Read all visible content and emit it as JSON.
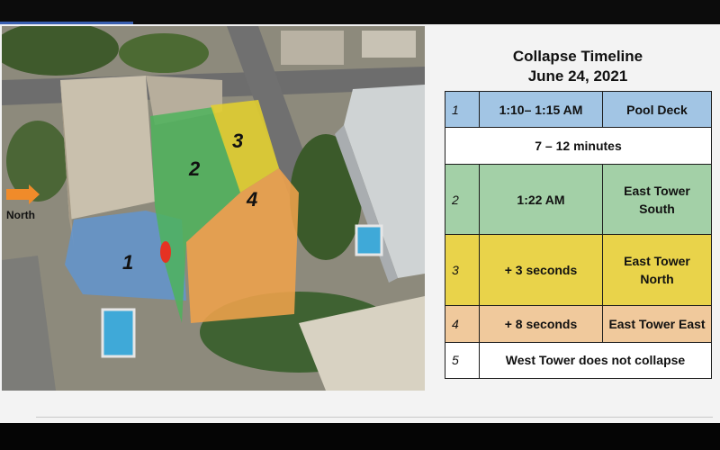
{
  "title": "Collapse Timeline",
  "subtitle": "June 24, 2021",
  "map": {
    "north_label": "North",
    "zones": [
      "1",
      "2",
      "3",
      "4"
    ]
  },
  "colors": {
    "pool_deck": "#a2c5e4",
    "south": "#a3d0a7",
    "north": "#e9d34a",
    "east": "#f0c99c"
  },
  "timeline": [
    {
      "num": "1",
      "time": "1:10– 1:15 AM",
      "event": "Pool Deck"
    },
    {
      "span": "7 – 12 minutes"
    },
    {
      "num": "2",
      "time": "1:22 AM",
      "event": "East Tower South"
    },
    {
      "num": "3",
      "time": "+ 3 seconds",
      "event": "East Tower North"
    },
    {
      "num": "4",
      "time": "+ 8 seconds",
      "event": "East Tower East"
    },
    {
      "num": "5",
      "event": "West Tower does not collapse"
    }
  ]
}
